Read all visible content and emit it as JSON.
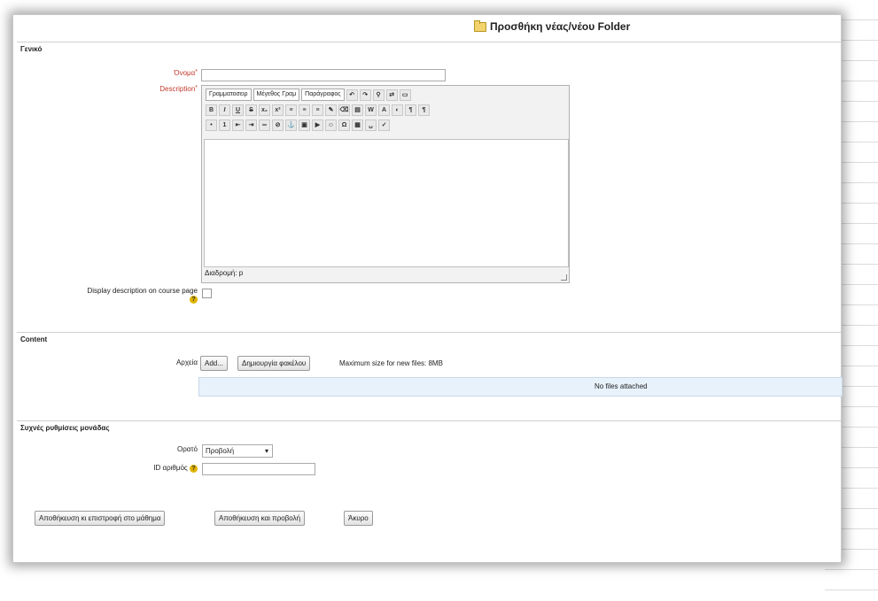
{
  "page": {
    "title": "Προσθήκη νέας/νέου Folder"
  },
  "general": {
    "legend": "Γενικό",
    "name_label": "Όνομα",
    "name_value": "",
    "description_label": "Description",
    "required_mark": "*",
    "editor": {
      "font_select": "Γραμματοσειρ",
      "size_select": "Μέγεθος Γραμ",
      "paragraph_select": "Παράγραφος",
      "path_text": "Διαδρομή: p"
    },
    "display_description_label": "Display description on course page"
  },
  "content": {
    "legend": "Content",
    "files_label": "Αρχεία",
    "add_button": "Add...",
    "create_folder_button": "Δημιουργία φακέλου",
    "max_size_text": "Maximum size for new files: 8MB",
    "no_files_text": "No files attached"
  },
  "module_settings": {
    "legend": "Συχνές ρυθμίσεις μονάδας",
    "visible_label": "Ορατό",
    "visible_value": "Προβολή",
    "id_label": "ID αριθμός",
    "id_value": ""
  },
  "actions": {
    "save_return": "Αποθήκευση κι επιστροφή στο μάθημα",
    "save_display": "Αποθήκευση και προβολή",
    "cancel": "Άκυρο"
  }
}
